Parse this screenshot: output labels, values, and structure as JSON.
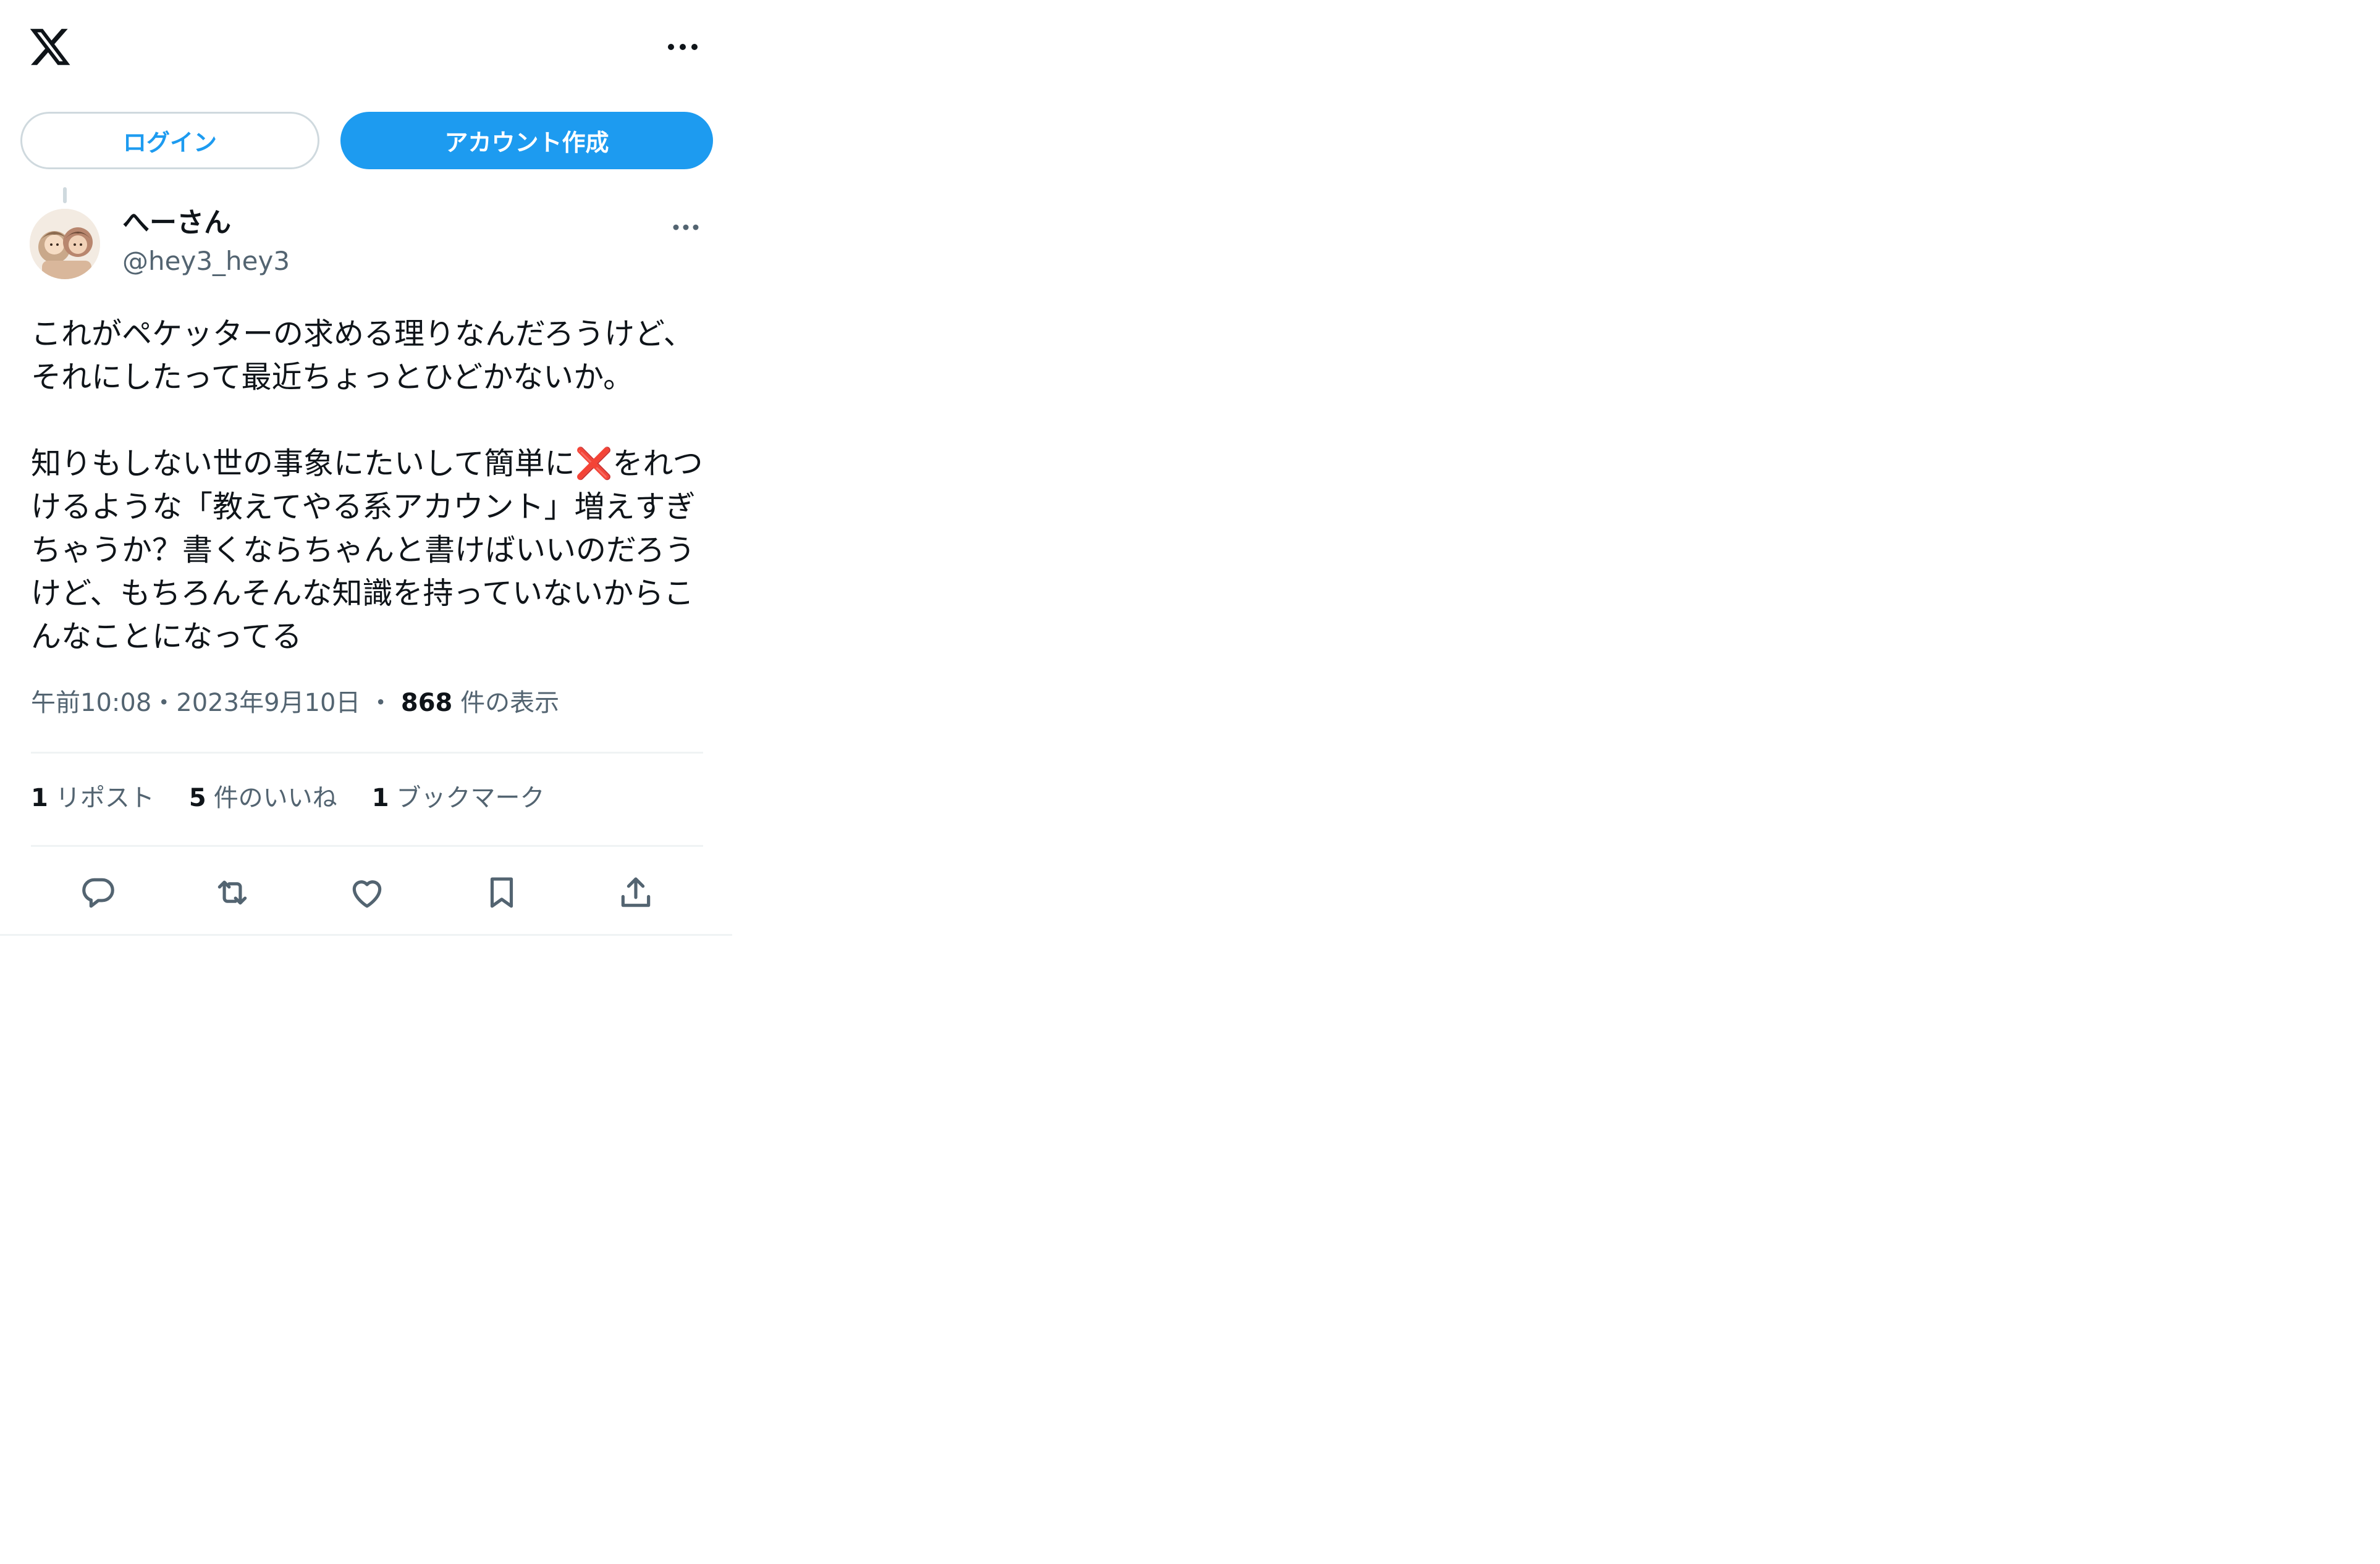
{
  "header": {
    "logo_icon": "x-logo-icon",
    "more_icon": "more-horizontal-icon"
  },
  "auth": {
    "login_label": "ログイン",
    "signup_label": "アカウント作成",
    "accent_color": "#1d9bf0"
  },
  "tweet": {
    "author": {
      "display_name": "へーさん",
      "handle": "@hey3_hey3",
      "avatar_icon": "avatar-illustration"
    },
    "text_part1": "これがペケッターの求める理りなんだろうけど、\nそれにしたって最近ちょっとひどかないか。\n\n知りもしない世の事象にたいして簡単に",
    "emoji": "❌",
    "text_part2": "をれつけるような「教えてやる系アカウント」増えすぎちゃうか？書くならちゃんと書けばいいのだろうけど、もちろんそんな知識を持っていないからこんなことになってる",
    "timestamp": "午前10:08・2023年9月10日",
    "separator": "・",
    "views_count": "868",
    "views_label": "件の表示",
    "stats": {
      "reposts_count": "1",
      "reposts_label": "リポスト",
      "likes_count": "5",
      "likes_label": "件のいいね",
      "bookmarks_count": "1",
      "bookmarks_label": "ブックマーク"
    },
    "actions": [
      "reply-icon",
      "repost-icon",
      "like-icon",
      "bookmark-icon",
      "share-icon"
    ]
  }
}
